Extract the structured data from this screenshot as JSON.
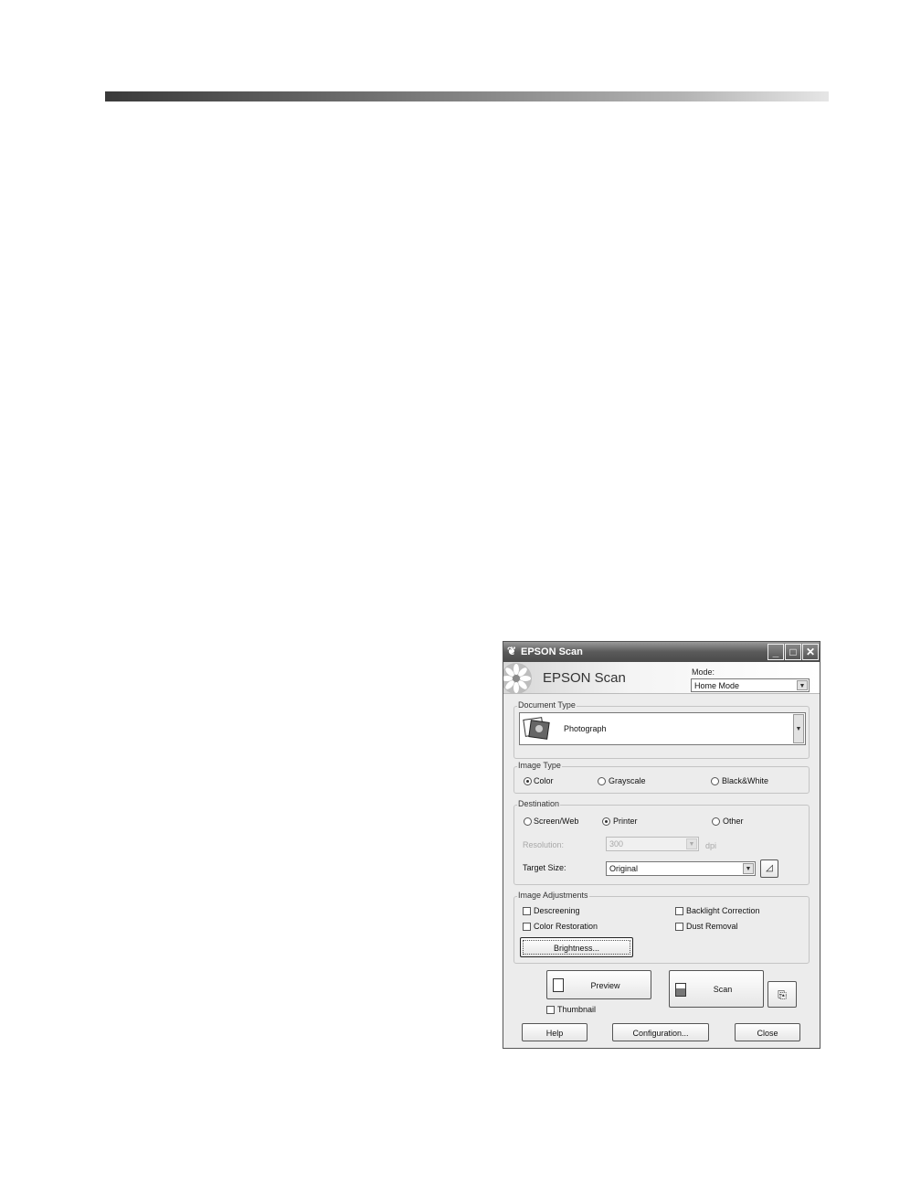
{
  "window": {
    "title": "EPSON Scan"
  },
  "header": {
    "title": "EPSON Scan",
    "mode_label": "Mode:",
    "mode_value": "Home Mode"
  },
  "document_type": {
    "label": "Document Type",
    "value": "Photograph"
  },
  "image_type": {
    "label": "Image Type",
    "options": [
      "Color",
      "Grayscale",
      "Black&White"
    ],
    "selected": "Color"
  },
  "destination": {
    "label": "Destination",
    "options": [
      "Screen/Web",
      "Printer",
      "Other"
    ],
    "selected": "Printer",
    "resolution_label": "Resolution:",
    "resolution_value": "300",
    "resolution_unit": "dpi",
    "target_size_label": "Target Size:",
    "target_size_value": "Original"
  },
  "image_adjustments": {
    "label": "Image Adjustments",
    "descreening": "Descreening",
    "backlight_correction": "Backlight Correction",
    "color_restoration": "Color Restoration",
    "dust_removal": "Dust Removal",
    "brightness_button": "Brightness..."
  },
  "actions": {
    "preview": "Preview",
    "scan": "Scan",
    "thumbnail": "Thumbnail",
    "help": "Help",
    "configuration": "Configuration...",
    "close": "Close"
  }
}
